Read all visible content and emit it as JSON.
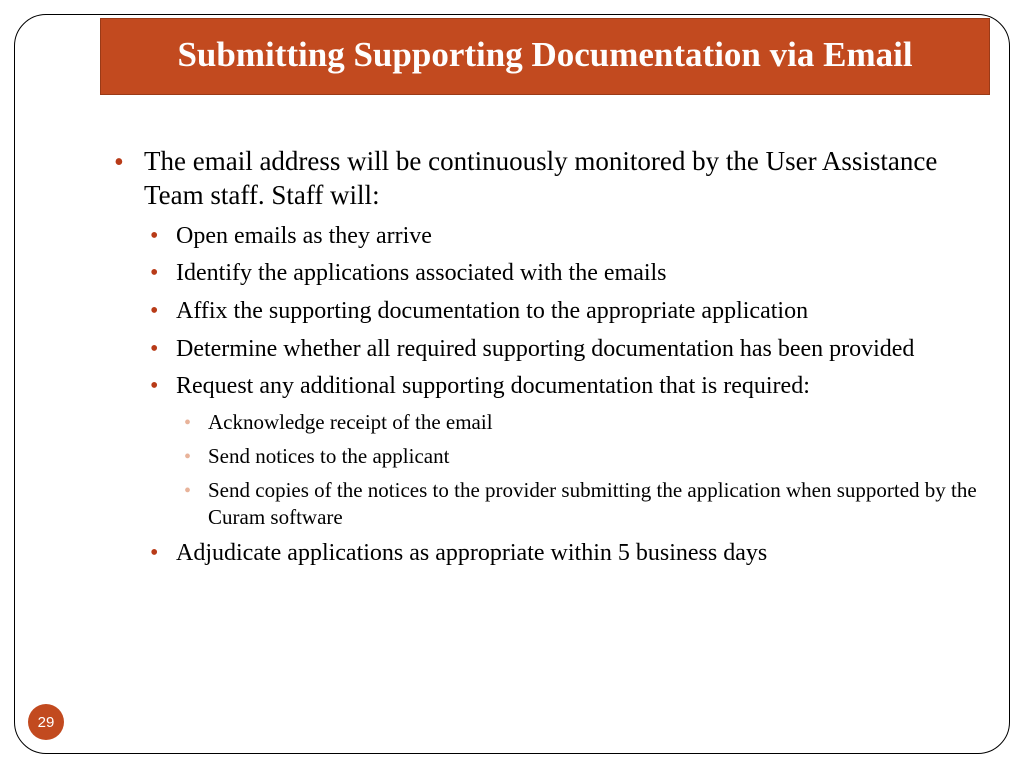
{
  "title": "Submitting Supporting Documentation via Email",
  "bullets": {
    "intro": "The email address will be continuously monitored by the User Assistance Team staff.  Staff will:",
    "items": [
      "Open emails as they arrive",
      "Identify the applications associated with the emails",
      "Affix the supporting documentation to the appropriate application",
      "Determine whether all required supporting documentation has been provided",
      "Request any additional supporting documentation that is required:"
    ],
    "subitems": [
      "Acknowledge receipt of the email",
      "Send notices to the applicant",
      "Send copies of the notices to the provider submitting the application when supported by the Curam software"
    ],
    "last": "Adjudicate applications as appropriate within 5 business days"
  },
  "page_number": "29"
}
